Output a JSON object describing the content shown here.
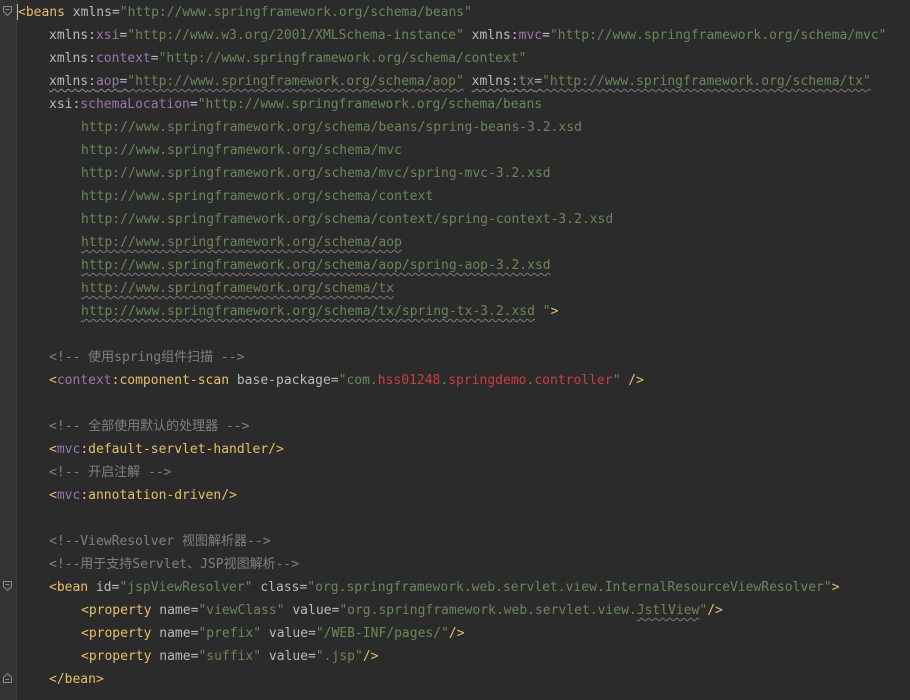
{
  "editor": {
    "colors": {
      "background": "#2b2b2b",
      "tag": "#e8bf6a",
      "attribute": "#bababa",
      "namespace": "#9876aa",
      "string": "#6a8759",
      "string_highlight": "#cc3d3d",
      "comment": "#808080"
    },
    "fold_icons": [
      "fold-open-icon",
      "fold-open-icon",
      "fold-close-icon"
    ],
    "lines": {
      "l1": {
        "open": "<",
        "tag": "beans",
        "a1": "xmlns",
        "eq1": "=",
        "v1": "\"http://www.springframework.org/schema/beans\""
      },
      "l2": {
        "p1": "xmlns",
        "c1": ":",
        "n1": "xsi",
        "eq1": "=",
        "v1": "\"http://www.w3.org/2001/XMLSchema-instance\"",
        "p2": "xmlns",
        "c2": ":",
        "n2": "mvc",
        "eq2": "=",
        "v2": "\"http://www.springframework.org/schema/mvc\""
      },
      "l3": {
        "p1": "xmlns",
        "c1": ":",
        "n1": "context",
        "eq1": "=",
        "v1": "\"http://www.springframework.org/schema/context\""
      },
      "l4": {
        "p1": "xmlns",
        "c1": ":",
        "n1": "aop",
        "eq1": "=",
        "v1": "\"http://www.springframework.org/schema/aop\"",
        "p2": "xmlns",
        "c2": ":",
        "n2": "tx",
        "eq2": "=",
        "v2": "\"http://www.springframework.org/schema/tx\""
      },
      "l5": {
        "p1": "xsi",
        "c1": ":",
        "n1": "schemaLocation",
        "eq1": "=",
        "v1": "\"http://www.springframework.org/schema/beans"
      },
      "l6": "http://www.springframework.org/schema/beans/spring-beans-3.2.xsd",
      "l7": "http://www.springframework.org/schema/mvc",
      "l8": "http://www.springframework.org/schema/mvc/spring-mvc-3.2.xsd",
      "l9": "http://www.springframework.org/schema/context",
      "l10": "http://www.springframework.org/schema/context/spring-context-3.2.xsd",
      "l11": "http://www.springframework.org/schema/aop",
      "l12": "http://www.springframework.org/schema/aop/spring-aop-3.2.xsd",
      "l13": "http://www.springframework.org/schema/tx",
      "l14": {
        "url": "http://www.springframework.org/schema/tx/spring-tx-3.2.xsd",
        "end": " \"",
        "close": ">"
      },
      "l16": "<!-- 使用spring组件扫描 -->",
      "l17": {
        "open": "<",
        "ns": "context",
        "colon": ":",
        "tag": "component-scan",
        "a1": "base-package",
        "eq1": "=",
        "q1": "\"",
        "v1a": "com.",
        "v1b": "hss01248",
        "v1c": ".",
        "v1d": "springdemo",
        "v1e": ".",
        "v1f": "controller",
        "q2": "\"",
        "close": " />"
      },
      "l19": "<!-- 全部使用默认的处理器 -->",
      "l20": {
        "open": "<",
        "ns": "mvc",
        "colon": ":",
        "tag": "default-servlet-handler",
        "close": "/>"
      },
      "l21": "<!-- 开启注解 -->",
      "l22": {
        "open": "<",
        "ns": "mvc",
        "colon": ":",
        "tag": "annotation-driven",
        "close": "/>"
      },
      "l24": "<!--ViewResolver 视图解析器-->",
      "l25": "<!--用于支持Servlet、JSP视图解析-->",
      "l26": {
        "open": "<",
        "tag": "bean",
        "a1": "id",
        "eq1": "=",
        "v1": "\"jspViewResolver\"",
        "a2": "class",
        "eq2": "=",
        "v2": "\"org.springframework.web.servlet.view.InternalResourceViewResolver\"",
        "close": ">"
      },
      "l27": {
        "open": "<",
        "tag": "property",
        "a1": "name",
        "eq1": "=",
        "v1": "\"viewClass\"",
        "a2": "value",
        "eq2": "=",
        "v2a": "\"org.springframework.web.servlet.view.",
        "v2b": "JstlView",
        "v2c": "\"",
        "close": "/>"
      },
      "l28": {
        "open": "<",
        "tag": "property",
        "a1": "name",
        "eq1": "=",
        "v1": "\"prefix\"",
        "a2": "value",
        "eq2": "=",
        "v2": "\"/WEB-INF/pages/\"",
        "close": "/>"
      },
      "l29": {
        "open": "<",
        "tag": "property",
        "a1": "name",
        "eq1": "=",
        "v1": "\"suffix\"",
        "a2": "value",
        "eq2": "=",
        "v2": "\".jsp\"",
        "close": "/>"
      },
      "l30": {
        "open": "</",
        "tag": "bean",
        "close": ">"
      }
    }
  }
}
